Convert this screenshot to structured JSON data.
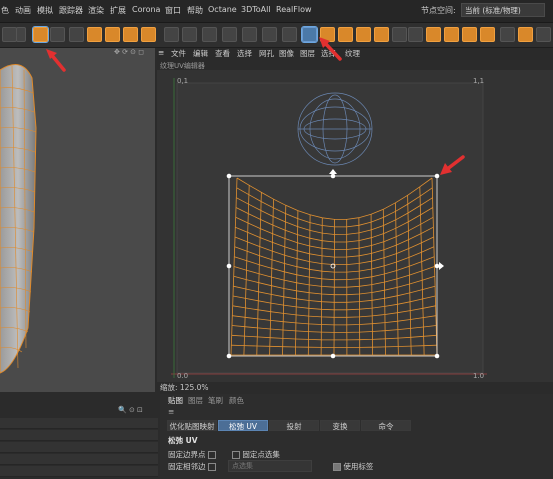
{
  "menu": {
    "items": [
      "色",
      "动画",
      "模拟",
      "跟踪器",
      "渲染",
      "扩展",
      "Corona",
      "窗口",
      "帮助",
      "Octane",
      "3DToAll",
      "RealFlow"
    ],
    "node_space_label": "节点空间:",
    "layout_value": "当前 (标准/物理)"
  },
  "uv_editor": {
    "menu": [
      "文件",
      "编辑",
      "查看",
      "选择",
      "网孔",
      "图像",
      "图层",
      "选择",
      "纹理"
    ],
    "title": "纹理UV编辑器",
    "corner_labels": {
      "top_left": "0,1",
      "top_right": "1,1",
      "bottom_left": "0.0",
      "bottom_right": "1.0"
    },
    "zoom_text": "缩放: 125.0%"
  },
  "bottom_right": {
    "main_tabs": [
      "贴图",
      "图层",
      "笔刷",
      "颜色"
    ],
    "sub_tabs": [
      "优化贴图映射",
      "松弛 UV",
      "投射",
      "变换",
      "命令"
    ],
    "active_sub_tab": "松弛 UV",
    "section_title": "松弛 UV",
    "options": {
      "pin_border": "固定边界点",
      "pin_selected": "固定点选集",
      "pin_neighbors": "固定相邻边",
      "point_set": "点选集",
      "use_tags": "使用标签"
    }
  },
  "colors": {
    "accent": "#d9882a",
    "selection": "#4c6e96",
    "arrow": "#e23030"
  }
}
